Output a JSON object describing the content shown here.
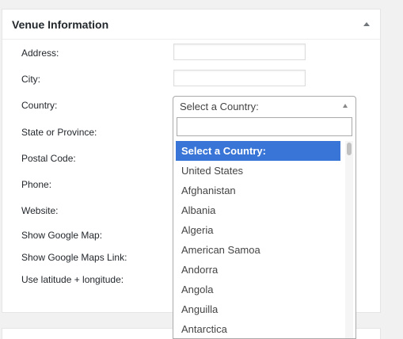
{
  "panel": {
    "title": "Venue Information"
  },
  "fields": {
    "address": "Address:",
    "city": "City:",
    "country": "Country:",
    "state": "State or Province:",
    "postal": "Postal Code:",
    "phone": "Phone:",
    "website": "Website:",
    "show_map": "Show Google Map:",
    "show_map_link": "Show Google Maps Link:",
    "latlng": "Use latitude + longitude:"
  },
  "inputs": {
    "address_value": "",
    "city_value": ""
  },
  "country_select": {
    "selected": "Select a Country:",
    "search_value": "",
    "options": [
      "Select a Country:",
      "United States",
      "Afghanistan",
      "Albania",
      "Algeria",
      "American Samoa",
      "Andorra",
      "Angola",
      "Anguilla",
      "Antarctica"
    ]
  },
  "icons": {
    "toggle": "triangle-up-icon",
    "search": "search-icon",
    "select_arrow": "triangle-up-icon"
  },
  "colors": {
    "highlight": "#3875d7",
    "panel_bg": "#ffffff",
    "page_bg": "#f1f1f1"
  }
}
